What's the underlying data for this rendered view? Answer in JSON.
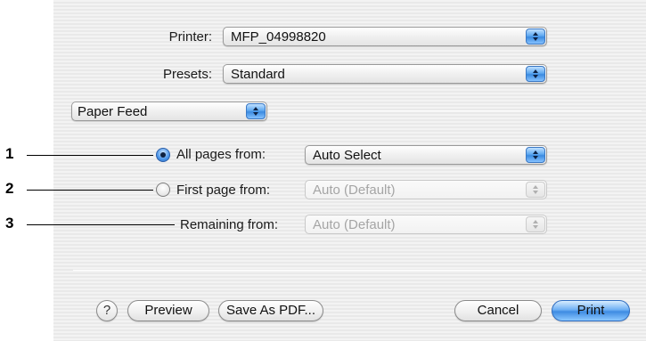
{
  "labels": {
    "printer": "Printer:",
    "presets": "Presets:",
    "all_pages_from": "All pages from:",
    "first_page_from": "First page from:",
    "remaining_from": "Remaining from:"
  },
  "popups": {
    "printer_value": "MFP_04998820",
    "presets_value": "Standard",
    "section_value": "Paper Feed",
    "all_pages_value": "Auto Select",
    "first_page_value": "Auto (Default)",
    "remaining_value": "Auto (Default)"
  },
  "callouts": [
    "1",
    "2",
    "3"
  ],
  "buttons": {
    "help": "?",
    "preview": "Preview",
    "save_as_pdf": "Save As PDF...",
    "cancel": "Cancel",
    "print": "Print"
  },
  "state": {
    "selected_radio": "all_pages_from",
    "first_page_popup_enabled": false,
    "remaining_popup_enabled": false
  },
  "colors": {
    "accent_blue": "#4b95e8",
    "disabled_text": "#a5a5a5",
    "callout_black": "#000000"
  },
  "icons": {
    "popup_arrows": "up-down-arrows-icon",
    "help": "question-mark-icon",
    "radio_selected": "radio-selected-icon",
    "radio_unselected": "radio-unselected-icon"
  }
}
